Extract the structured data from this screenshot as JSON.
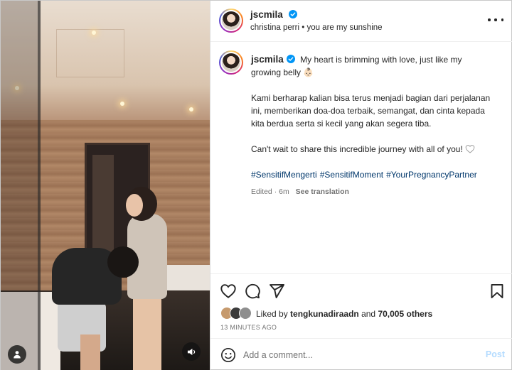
{
  "post": {
    "username": "jscmila",
    "audio": "christina perri • you are my sunshine",
    "more_icon": "more-horizontal-icon",
    "verified_color": "#0095f6"
  },
  "caption": {
    "username": "jscmila",
    "line1": "My heart is brimming with love, just like my growing belly",
    "line1_emoji": "👶🏻",
    "para2": "Kami berharap kalian bisa terus menjadi bagian dari perjalanan ini, memberikan doa-doa terbaik, semangat, dan cinta kepada kita berdua serta si kecil yang akan segera tiba.",
    "para3": "Can't wait to share this incredible journey with all of you!",
    "hashtags": [
      "#SensitifMengerti",
      "#SensitifMoment",
      "#YourPregnancyPartner"
    ],
    "edited": "Edited · 6m",
    "see_translation": "See translation"
  },
  "actions": {
    "icons": [
      "heart-icon",
      "comment-icon",
      "share-icon",
      "bookmark-icon"
    ]
  },
  "likes": {
    "prefix": "Liked by",
    "user": "tengkunadiraadn",
    "and": "and",
    "count": "70,005 others"
  },
  "timestamp": "13 MINUTES AGO",
  "comment": {
    "placeholder": "Add a comment...",
    "post_label": "Post"
  },
  "media": {
    "user_tag_icon": "user-tag-icon",
    "sound_icon": "sound-icon"
  }
}
